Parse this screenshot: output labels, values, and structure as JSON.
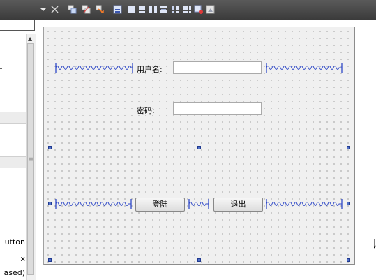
{
  "toolbar": {
    "icons": [
      "dropdown-arrow",
      "close-icon",
      "edit-widgets-icon",
      "edit-signals-icon",
      "edit-buddies-icon",
      "edit-tab-order-icon",
      "layout-horizontal-icon",
      "layout-vertical-icon",
      "layout-horizontal-splitter-icon",
      "layout-vertical-splitter-icon",
      "layout-form-icon",
      "layout-grid-icon",
      "break-layout-icon",
      "adjust-size-icon"
    ]
  },
  "left_panel": {
    "filter_value": "",
    "items_visible": [
      "utton",
      "x",
      "ased)"
    ],
    "bands": [
      "",
      ""
    ]
  },
  "form": {
    "username_label": "用户名:",
    "username_value": "",
    "password_label": "密码:",
    "password_value": "",
    "login_button": "登陆",
    "exit_button": "退出"
  },
  "colors": {
    "toolbar": "#474747",
    "grid_background": "#f0f0f0",
    "spacer": "#2f49c8",
    "handle": "#5070c8"
  }
}
